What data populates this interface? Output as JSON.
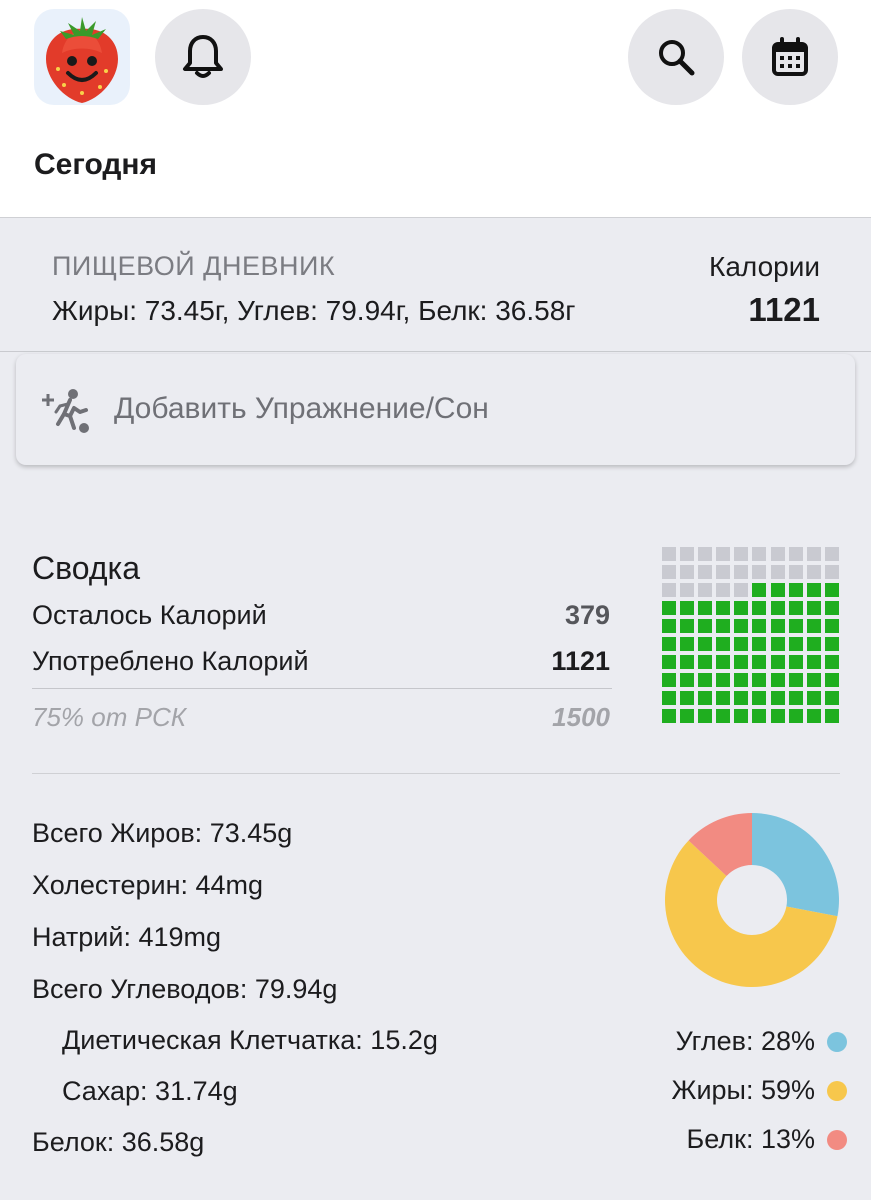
{
  "header": {
    "title": "Сегодня",
    "logo_icon": "strawberry-logo",
    "buttons": [
      "bell-icon",
      "search-icon",
      "calendar-icon"
    ]
  },
  "diary": {
    "title": "ПИЩЕВОЙ ДНЕВНИК",
    "macros_text": "Жиры: 73.45г, Углев: 79.94г, Белк: 36.58г",
    "calories_label": "Калории",
    "calories_value": "1121"
  },
  "exercise": {
    "label": "Добавить Упражнение/Сон",
    "icon": "add-exercise-icon"
  },
  "summary": {
    "title": "Сводка",
    "remaining_label": "Осталось Калорий",
    "remaining_value": "379",
    "consumed_label": "Употреблено Калорий",
    "consumed_value": "1121",
    "rsk_label": "75% от РСК",
    "rsk_value": "1500",
    "waffle": {
      "total_cells": 100,
      "filled_cells": 75,
      "filled_color": "#1fae1f",
      "empty_color": "#c9cad1"
    }
  },
  "nutrients": {
    "total_fat": "Всего Жиров: 73.45g",
    "cholesterol": "Холестерин: 44mg",
    "sodium": "Натрий: 419mg",
    "total_carbs": "Всего Углеводов: 79.94g",
    "fiber": "Диетическая Клетчатка: 15.2g",
    "sugar": "Сахар: 31.74g",
    "protein": "Белок: 36.58g"
  },
  "chart_data": {
    "type": "pie",
    "title": "",
    "categories": [
      "Углев",
      "Жиры",
      "Белк"
    ],
    "values": [
      28,
      59,
      13
    ],
    "colors": [
      "#7cc4de",
      "#f7c74c",
      "#f28b82"
    ],
    "donut": true,
    "legend_position": "right-bottom"
  },
  "legend": [
    {
      "label": "Углев: 28%",
      "color": "#7cc4de"
    },
    {
      "label": "Жиры: 59%",
      "color": "#f7c74c"
    },
    {
      "label": "Белк: 13%",
      "color": "#f28b82"
    }
  ]
}
